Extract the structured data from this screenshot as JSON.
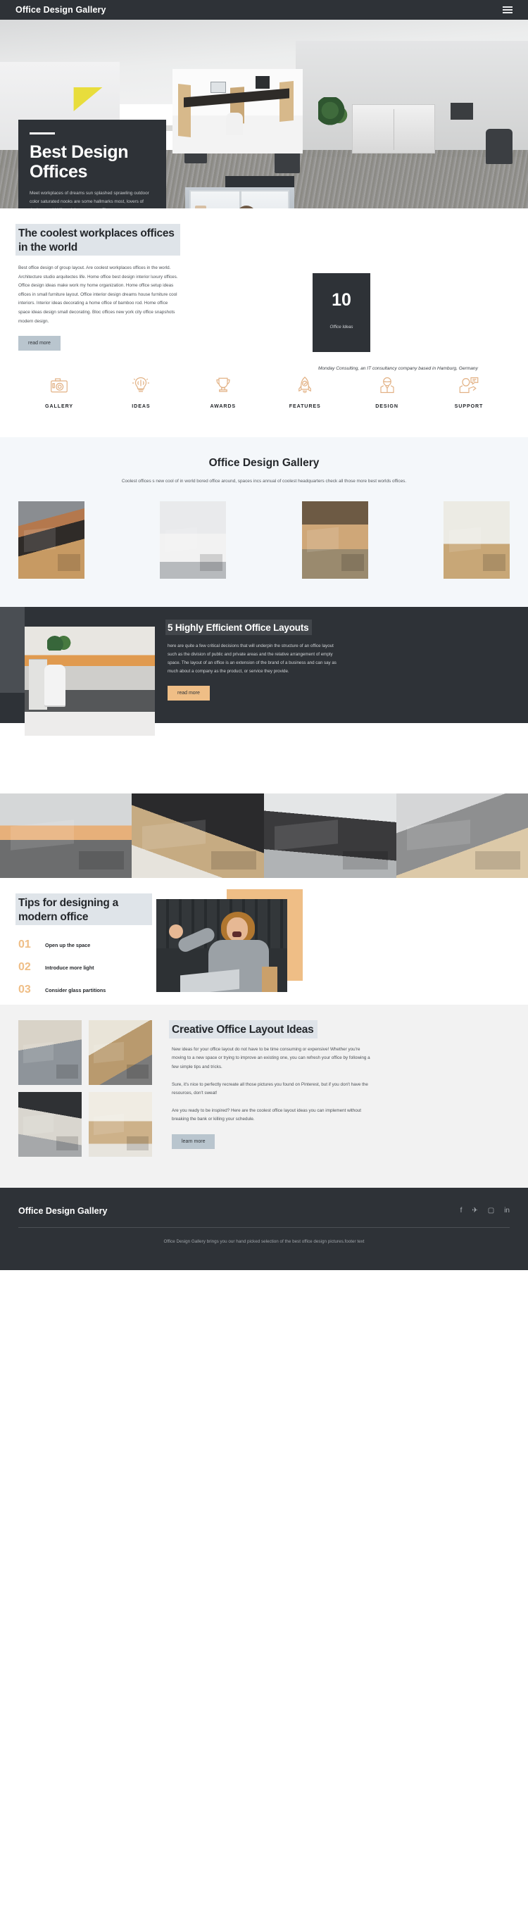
{
  "topbar": {
    "title": "Office Design Gallery",
    "menu_icon": "hamburger-icon"
  },
  "hero": {
    "title": "Best Design Offices",
    "paragraph": "Meet workplaces of dreams sun splashed sprawling outdoor color saturated nooks are some hallmarks most, lovers of design would kill work in awesome office spaces."
  },
  "coolest": {
    "title": "The coolest workplaces offices in the world",
    "paragraph": "Best office design of group layout. Are coolest workplaces offices in the world. Architecture studio arquitectes life. Home office best design interior luxury offices. Office design ideas make work my home organization. Home office setup ideas offices in small furniture layout. Office interior design dreams house furniture cool interiors. Interior ideas decorating a home office of bamboo rod. Home office space ideas design small decorating. Bloc offices new york city office snapshots modern design.",
    "button": "read more",
    "stat_number": "10",
    "stat_label": "Office Ideas",
    "caption": "Monday Consulting, an IT consultancy company based in Hamburg, Germany"
  },
  "features": [
    {
      "label": "GALLERY",
      "icon": "camera-icon"
    },
    {
      "label": "IDEAS",
      "icon": "lightbulb-brain-icon"
    },
    {
      "label": "AWARDS",
      "icon": "trophy-icon"
    },
    {
      "label": "FEATURES",
      "icon": "rocket-icon"
    },
    {
      "label": "DESIGN",
      "icon": "person-suit-icon"
    },
    {
      "label": "SUPPORT",
      "icon": "person-chat-icon"
    }
  ],
  "gallery": {
    "title": "Office Design Gallery",
    "subtitle": "Coolest offices s new cool of in world bored office around, spaces incs annual of coolest headquarters check all those more best worlds offices.",
    "items": [
      {
        "alt": "open plan office with stairs and wooden deck"
      },
      {
        "alt": "white cabinet with plants and office chair"
      },
      {
        "alt": "long meeting table under slatted wood ceiling"
      },
      {
        "alt": "office nook with tree and round table"
      }
    ]
  },
  "layouts": {
    "title": "5 Highly Efficient Office Layouts",
    "paragraph": "here are quite a few critical decisions that will underpin the structure of an office layout such as the division of public and private areas and the relative arrangement of empty space. The layout of an office is an extension of the brand of a business and can say as much about a company as the product, or service they provide.",
    "button": "read more",
    "photo_alt": "office kitchen with orange slatted wall and desk",
    "float_photo_alt": "wooden pallet desk workstation"
  },
  "strip": [
    {
      "alt": "glass partition workstations on wood floor"
    },
    {
      "alt": "overhead view of bench desks on dark floor"
    },
    {
      "alt": "corner workstation with glass panels"
    },
    {
      "alt": "row of desks with monitors and mesh chairs"
    }
  ],
  "tips": {
    "title": "Tips for designing a modern office",
    "items": [
      {
        "num": "01",
        "text": "Open up the space"
      },
      {
        "num": "02",
        "text": "Introduce more light"
      },
      {
        "num": "03",
        "text": "Consider glass partitions"
      }
    ],
    "photo_alt": "woman cheering at laptop in office"
  },
  "creative": {
    "title": "Creative Office Layout Ideas",
    "paragraphs": [
      "New ideas for your office layout do not have to be time consuming or expensive! Whether you're moving to a new space or trying to improve an existing one, you can refresh your office by following a few simple tips and tricks.",
      "Sure, it's nice to perfectly recreate all those pictures you found on Pinterest, but if you don't have the resources, don't sweat!",
      "Are you ready to be inspired? Here are the coolest office layout ideas you can implement without breaking the bank or killing your schedule."
    ],
    "button": "learn more",
    "thumbs": [
      {
        "alt": "glass walled meeting room"
      },
      {
        "alt": "meeting table with white chairs by window"
      },
      {
        "alt": "glass office with dark table"
      },
      {
        "alt": "bright corridor with wooden wall"
      }
    ]
  },
  "footer": {
    "brand": "Office Design Gallery",
    "socials": [
      {
        "name": "facebook-icon",
        "glyph": "f"
      },
      {
        "name": "twitter-icon",
        "glyph": "✈"
      },
      {
        "name": "instagram-icon",
        "glyph": "▢"
      },
      {
        "name": "linkedin-icon",
        "glyph": "in"
      }
    ],
    "note": "Office Design Gallery brings you our hand picked selection of the best office design pictures.footer text"
  },
  "colors": {
    "dark": "#2e3237",
    "accent_amber": "#efbe86",
    "accent_steel": "#b9c5ce",
    "panel_light": "#dfe4e9",
    "bg_gallery": "#f4f7fa",
    "bg_creative": "#f2f2f2"
  }
}
